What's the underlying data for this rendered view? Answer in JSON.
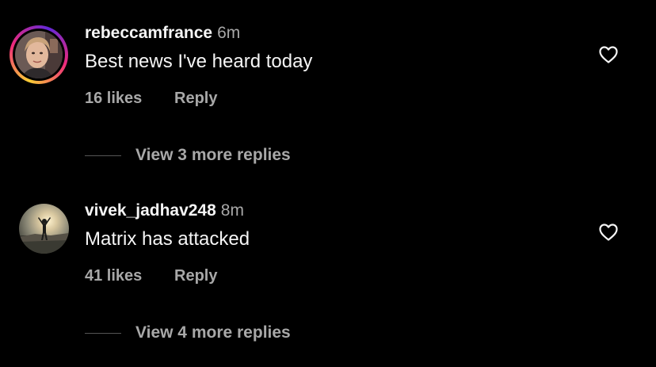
{
  "comments": [
    {
      "username": "rebeccamfrance",
      "time": "6m",
      "text": "Best news I've heard today",
      "likes": "16 likes",
      "reply": "Reply",
      "view_more": "View 3 more replies",
      "has_story_ring": true,
      "like_icon": "heart-outline-icon"
    },
    {
      "username": "vivek_jadhav248",
      "time": "8m",
      "text": "Matrix has attacked",
      "likes": "41 likes",
      "reply": "Reply",
      "view_more": "View 4 more replies",
      "has_story_ring": false,
      "like_icon": "heart-outline-icon"
    }
  ],
  "colors": {
    "background": "#000000",
    "primary_text": "#f5f5f5",
    "secondary_text": "#a8a8a8",
    "divider": "#555555"
  }
}
